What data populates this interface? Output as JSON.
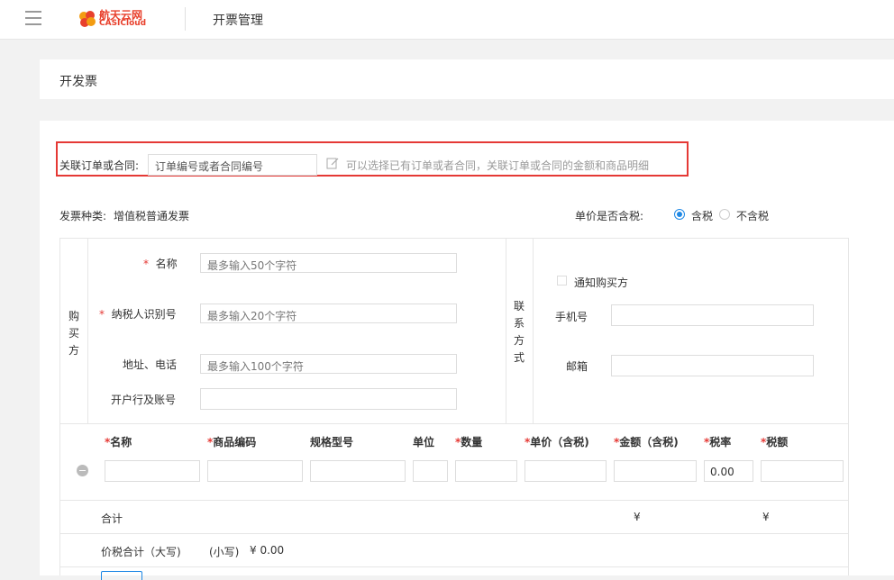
{
  "header": {
    "logo_cn": "航天云网",
    "logo_en": "CASICloud",
    "title": "开票管理"
  },
  "page_title": "开发票",
  "link_order": {
    "label": "关联订单或合同:",
    "placeholder": "订单编号或者合同编号",
    "hint": "可以选择已有订单或者合同，关联订单或合同的金额和商品明细"
  },
  "invoice_type": {
    "label": "发票种类:",
    "value": "增值税普通发票"
  },
  "tax_included": {
    "label": "单价是否含税:",
    "options": [
      "含税",
      "不含税"
    ],
    "selected": "含税"
  },
  "buyer": {
    "section_label": [
      "购",
      "买",
      "方"
    ],
    "name_label": "名称",
    "name_placeholder": "最多输入50个字符",
    "taxid_label": "纳税人识别号",
    "taxid_placeholder": "最多输入20个字符",
    "address_label": "地址、电话",
    "address_placeholder": "最多输入100个字符",
    "bank_label": "开户行及账号",
    "bank_placeholder": ""
  },
  "contact": {
    "section_label": [
      "联",
      "系",
      "方",
      "式"
    ],
    "notify_label": "通知购买方",
    "phone_label": "手机号",
    "email_label": "邮箱"
  },
  "items": {
    "headers": [
      {
        "label": "名称",
        "required": true
      },
      {
        "label": "商品编码",
        "required": true
      },
      {
        "label": "规格型号",
        "required": false
      },
      {
        "label": "单位",
        "required": false
      },
      {
        "label": "数量",
        "required": true
      },
      {
        "label": "单价（含税)",
        "required": true
      },
      {
        "label": "金额（含税)",
        "required": true
      },
      {
        "label": "税率",
        "required": true
      },
      {
        "label": "税额",
        "required": true
      }
    ],
    "row": {
      "tax_rate": "0.00"
    }
  },
  "total": {
    "label": "合计",
    "amount": "¥",
    "tax": "¥"
  },
  "grand_total": {
    "label": "价税合计（大写)",
    "small_label": "(小写)",
    "small_value": "¥ 0.00"
  }
}
